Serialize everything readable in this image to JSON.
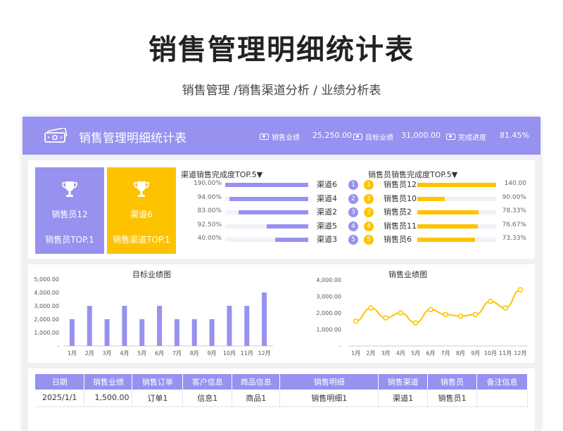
{
  "page": {
    "title": "销售管理明细统计表",
    "subtitle": "销售管理 /销售渠道分析 / 业绩分析表"
  },
  "header": {
    "title": "销售管理明细统计表",
    "kpis": [
      {
        "icon": "money-icon",
        "label": "销售业绩",
        "value": "25,250.00"
      },
      {
        "icon": "money-icon",
        "label": "目标业绩",
        "value": "31,000.00"
      },
      {
        "icon": "money-icon",
        "label": "完成进度",
        "value": "81.45%"
      }
    ]
  },
  "cards": [
    {
      "icon": "trophy-icon",
      "name": "销售员12",
      "label": "销售员TOP.1",
      "color": "#9791ef"
    },
    {
      "icon": "trophy-icon",
      "name": "渠道6",
      "label": "销售渠道TOP.1",
      "color": "#fdc300"
    }
  ],
  "channel_rank": {
    "title": "渠道销售完成度TOP.5▼",
    "color": "#9791ef",
    "rows": [
      {
        "pct": "190.00%",
        "value": 1.0,
        "name": "渠道6"
      },
      {
        "pct": "94.00%",
        "value": 0.95,
        "name": "渠道4"
      },
      {
        "pct": "83.00%",
        "value": 0.84,
        "name": "渠道2"
      },
      {
        "pct": "92.50%",
        "value": 0.5,
        "name": "渠道5"
      },
      {
        "pct": "40.00%",
        "value": 0.4,
        "name": "渠道3"
      }
    ]
  },
  "seller_rank": {
    "title": "销售员销售完成度TOP.5▼",
    "color": "#fdc300",
    "rank_colors": [
      "#9791ef",
      "#fdc300"
    ],
    "rows": [
      {
        "rank": "1",
        "name": "销售员12",
        "value": 1.0,
        "pct": "140.00"
      },
      {
        "rank": "2",
        "name": "销售员10",
        "value": 0.35,
        "pct": "90.00%"
      },
      {
        "rank": "3",
        "name": "销售员2",
        "value": 0.78,
        "pct": "78.33%"
      },
      {
        "rank": "4",
        "name": "销售员11",
        "value": 0.77,
        "pct": "76.67%"
      },
      {
        "rank": "5",
        "name": "销售员6",
        "value": 0.73,
        "pct": "73.33%"
      }
    ]
  },
  "chart_data": [
    {
      "type": "bar",
      "title": "目标业绩图",
      "categories": [
        "1月",
        "2月",
        "3月",
        "4月",
        "5月",
        "6月",
        "7月",
        "8月",
        "9月",
        "10月",
        "11月",
        "12月"
      ],
      "values": [
        2000,
        3000,
        2000,
        3000,
        2000,
        3000,
        2000,
        2000,
        2000,
        3000,
        3000,
        4000
      ],
      "ylim": [
        0,
        5000
      ],
      "yticks": [
        "5,000.00",
        "4,000.00",
        "3,000.00",
        "2,000.00",
        "1,000.00",
        "-"
      ],
      "color": "#9791ef"
    },
    {
      "type": "line",
      "title": "销售业绩图",
      "categories": [
        "1月",
        "2月",
        "3月",
        "4月",
        "5月",
        "6月",
        "7月",
        "8月",
        "9月",
        "10月",
        "11月",
        "12月"
      ],
      "values": [
        1500,
        2300,
        1700,
        2000,
        1400,
        2200,
        1900,
        1800,
        1900,
        2700,
        2300,
        3400
      ],
      "ylim": [
        0,
        4000
      ],
      "yticks": [
        "4,000.00",
        "3,000.00",
        "2,000.00",
        "1,000.00",
        "-"
      ],
      "color": "#fdc300"
    }
  ],
  "table": {
    "headers": [
      "日期",
      "销售业绩",
      "销售订单",
      "客户信息",
      "商品信息",
      "销售明细",
      "销售渠道",
      "销售员",
      "备注信息"
    ],
    "rows": [
      [
        "2025/1/1",
        "1,500.00",
        "订单1",
        "信息1",
        "商品1",
        "销售明细1",
        "渠道1",
        "销售员1",
        ""
      ]
    ]
  }
}
